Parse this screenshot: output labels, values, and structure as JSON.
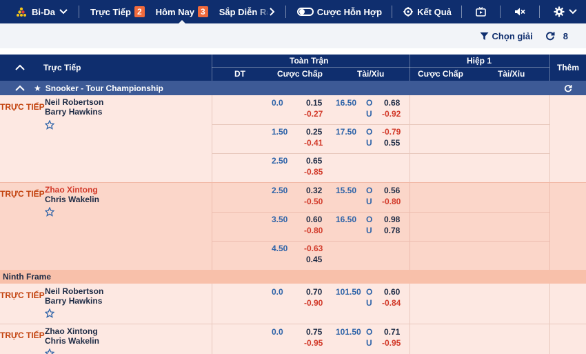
{
  "topbar": {
    "sport": "Bi-Da",
    "live_label": "Trực Tiếp",
    "live_count": "2",
    "today_label": "Hôm Nay",
    "today_count": "3",
    "upcoming_label": "Sắp Diễn Ra",
    "parlay_label": "Cược Hỗn Hợp",
    "results_label": "Kết Quả"
  },
  "subbar": {
    "select_league": "Chọn giải",
    "refresh_count": "8"
  },
  "header": {
    "live_col": "Trực Tiếp",
    "full_match": "Toàn Trận",
    "first_half": "Hiệp 1",
    "dt": "DT",
    "handicap": "Cược Chấp",
    "over_under": "Tài/Xỉu",
    "handicap_h1": "Cược Chấp",
    "over_under_h1": "Tài/Xỉu",
    "more": "Thêm"
  },
  "league": {
    "name": "Snooker - Tour Championship"
  },
  "frame_group": {
    "name": "Ninth Frame"
  },
  "live_tag": "TRỰC TIẾP",
  "o_label": "O",
  "u_label": "U",
  "matches": [
    {
      "home": "Neil Robertson",
      "away": "Barry Hawkins",
      "lines": [
        {
          "hdp": "0.0",
          "hdp_home": "0.15",
          "hdp_away": "-0.27",
          "ou": "16.50",
          "over": "0.68",
          "under": "-0.92"
        },
        {
          "hdp": "1.50",
          "hdp_home": "0.25",
          "hdp_away": "-0.41",
          "ou": "17.50",
          "over": "-0.79",
          "under": "0.55"
        },
        {
          "hdp": "2.50",
          "hdp_home": "0.65",
          "hdp_away": "-0.85",
          "ou": "",
          "over": "",
          "under": ""
        }
      ]
    },
    {
      "home": "Zhao Xintong",
      "away": "Chris Wakelin",
      "lines": [
        {
          "hdp": "2.50",
          "hdp_home": "0.32",
          "hdp_away": "-0.50",
          "ou": "15.50",
          "over": "0.56",
          "under": "-0.80"
        },
        {
          "hdp": "3.50",
          "hdp_home": "0.60",
          "hdp_away": "-0.80",
          "ou": "16.50",
          "over": "0.98",
          "under": "0.78"
        },
        {
          "hdp": "4.50",
          "hdp_home": "-0.63",
          "hdp_away": "0.45",
          "ou": "",
          "over": "",
          "under": ""
        }
      ]
    }
  ],
  "frame_matches": [
    {
      "home": "Neil Robertson",
      "away": "Barry Hawkins",
      "hdp": "0.0",
      "hdp_home": "0.70",
      "hdp_away": "-0.90",
      "ou": "101.50",
      "over": "0.60",
      "under": "-0.84"
    },
    {
      "home": "Zhao Xintong",
      "away": "Chris Wakelin",
      "hdp": "0.0",
      "hdp_home": "0.75",
      "hdp_away": "-0.95",
      "ou": "101.50",
      "over": "0.71",
      "under": "-0.95"
    }
  ],
  "colors": {
    "navy": "#0f2e6e",
    "league_bar": "#3d5a96",
    "badge": "#f06a3c",
    "row_light": "#fde8e2",
    "row_dark": "#fbd6c9",
    "frame_bar": "#f8c0aa",
    "negative": "#d23a2a",
    "live": "#c2410c"
  }
}
